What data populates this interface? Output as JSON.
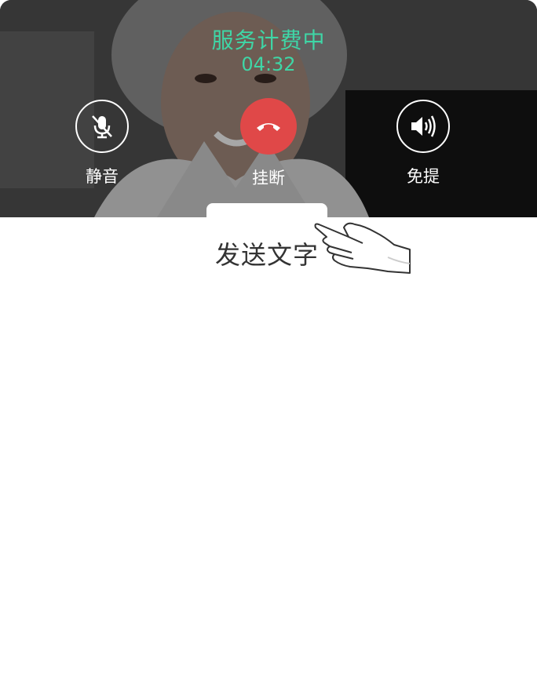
{
  "call": {
    "status": "服务计费中",
    "timer": "04:32"
  },
  "controls": {
    "mute_label": "静音",
    "mute_icon": "mic-off-icon",
    "hangup_label": "挂断",
    "hangup_icon": "phone-hangup-icon",
    "hangup_color": "#e04848",
    "speaker_label": "免提",
    "speaker_icon": "speaker-icon"
  },
  "send_text": {
    "label": "发送文字",
    "hint_icon": "pointing-hand-icon"
  },
  "colors": {
    "accent": "#3fd6a6"
  }
}
